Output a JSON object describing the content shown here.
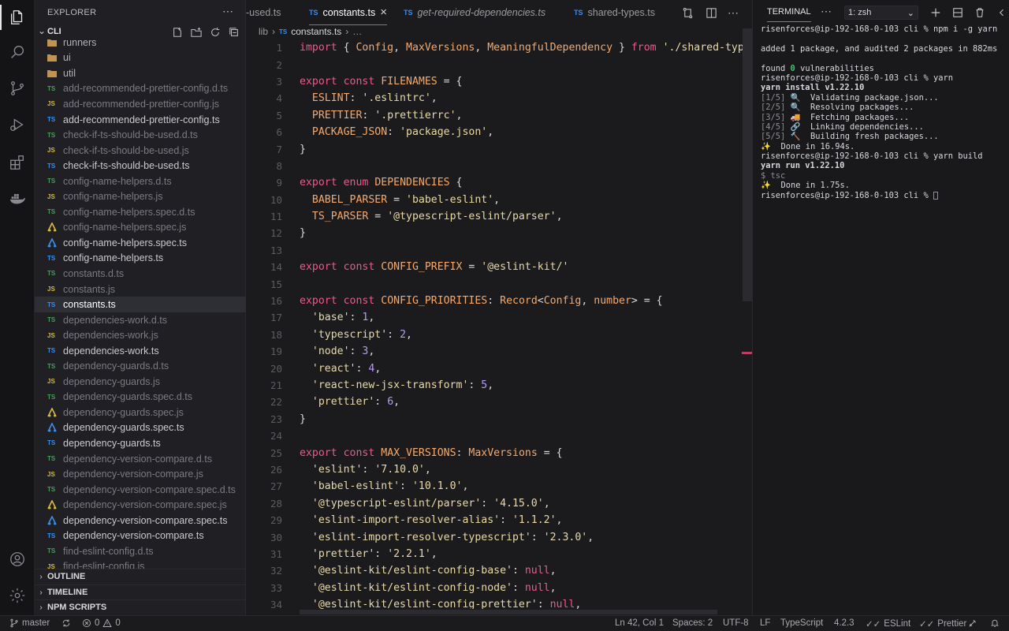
{
  "explorer": {
    "title": "EXPLORER",
    "folder": "CLI",
    "files": [
      {
        "name": "runners",
        "kind": "folder"
      },
      {
        "name": "ui",
        "kind": "folder"
      },
      {
        "name": "util",
        "kind": "folder"
      },
      {
        "name": "add-recommended-prettier-config.d.ts",
        "icon": "TS",
        "kind": "tsd"
      },
      {
        "name": "add-recommended-prettier-config.js",
        "icon": "JS",
        "kind": "js"
      },
      {
        "name": "add-recommended-prettier-config.ts",
        "icon": "TS",
        "kind": "ts"
      },
      {
        "name": "check-if-ts-should-be-used.d.ts",
        "icon": "TS",
        "kind": "tsd"
      },
      {
        "name": "check-if-ts-should-be-used.js",
        "icon": "JS",
        "kind": "js"
      },
      {
        "name": "check-if-ts-should-be-used.ts",
        "icon": "TS",
        "kind": "ts"
      },
      {
        "name": "config-name-helpers.d.ts",
        "icon": "TS",
        "kind": "tsd"
      },
      {
        "name": "config-name-helpers.js",
        "icon": "JS",
        "kind": "js"
      },
      {
        "name": "config-name-helpers.spec.d.ts",
        "icon": "TS",
        "kind": "tsd"
      },
      {
        "name": "config-name-helpers.spec.js",
        "icon": "jest",
        "kind": "jestjs"
      },
      {
        "name": "config-name-helpers.spec.ts",
        "icon": "jest",
        "kind": "jestts"
      },
      {
        "name": "config-name-helpers.ts",
        "icon": "TS",
        "kind": "ts"
      },
      {
        "name": "constants.d.ts",
        "icon": "TS",
        "kind": "tsd"
      },
      {
        "name": "constants.js",
        "icon": "JS",
        "kind": "js"
      },
      {
        "name": "constants.ts",
        "icon": "TS",
        "kind": "ts",
        "selected": true
      },
      {
        "name": "dependencies-work.d.ts",
        "icon": "TS",
        "kind": "tsd"
      },
      {
        "name": "dependencies-work.js",
        "icon": "JS",
        "kind": "js"
      },
      {
        "name": "dependencies-work.ts",
        "icon": "TS",
        "kind": "ts"
      },
      {
        "name": "dependency-guards.d.ts",
        "icon": "TS",
        "kind": "tsd"
      },
      {
        "name": "dependency-guards.js",
        "icon": "JS",
        "kind": "js"
      },
      {
        "name": "dependency-guards.spec.d.ts",
        "icon": "TS",
        "kind": "tsd"
      },
      {
        "name": "dependency-guards.spec.js",
        "icon": "jest",
        "kind": "jestjs"
      },
      {
        "name": "dependency-guards.spec.ts",
        "icon": "jest",
        "kind": "jestts"
      },
      {
        "name": "dependency-guards.ts",
        "icon": "TS",
        "kind": "ts"
      },
      {
        "name": "dependency-version-compare.d.ts",
        "icon": "TS",
        "kind": "tsd"
      },
      {
        "name": "dependency-version-compare.js",
        "icon": "JS",
        "kind": "js"
      },
      {
        "name": "dependency-version-compare.spec.d.ts",
        "icon": "TS",
        "kind": "tsd"
      },
      {
        "name": "dependency-version-compare.spec.js",
        "icon": "jest",
        "kind": "jestjs"
      },
      {
        "name": "dependency-version-compare.spec.ts",
        "icon": "jest",
        "kind": "jestts"
      },
      {
        "name": "dependency-version-compare.ts",
        "icon": "TS",
        "kind": "ts"
      },
      {
        "name": "find-eslint-config.d.ts",
        "icon": "TS",
        "kind": "tsd"
      },
      {
        "name": "find-eslint-config.js",
        "icon": "JS",
        "kind": "js"
      }
    ],
    "sections": [
      "OUTLINE",
      "TIMELINE",
      "NPM SCRIPTS"
    ]
  },
  "tabs": [
    {
      "label": "-used.ts",
      "icon": "",
      "active": false,
      "italic": false
    },
    {
      "label": "constants.ts",
      "icon": "TS",
      "active": true,
      "italic": false,
      "close": "×"
    },
    {
      "label": "get-required-dependencies.ts",
      "icon": "TS",
      "active": false,
      "italic": true
    },
    {
      "label": "shared-types.ts",
      "icon": "TS",
      "active": false,
      "italic": false
    }
  ],
  "breadcrumb": {
    "root": "lib",
    "sep": "›",
    "icon": "TS",
    "file": "constants.ts",
    "more": "…"
  },
  "code": [
    [
      [
        "k",
        "import"
      ],
      [
        "p",
        " { "
      ],
      [
        "t",
        "Config"
      ],
      [
        "p",
        ", "
      ],
      [
        "t",
        "MaxVersions"
      ],
      [
        "p",
        ", "
      ],
      [
        "t",
        "MeaningfulDependency"
      ],
      [
        "p",
        " } "
      ],
      [
        "k",
        "from"
      ],
      [
        "p",
        " "
      ],
      [
        "s",
        "'./shared-types'"
      ]
    ],
    [],
    [
      [
        "k",
        "export"
      ],
      [
        "p",
        " "
      ],
      [
        "k",
        "const"
      ],
      [
        "p",
        " "
      ],
      [
        "t",
        "FILENAMES"
      ],
      [
        "p",
        " = {"
      ]
    ],
    [
      [
        "p",
        "  "
      ],
      [
        "t",
        "ESLINT"
      ],
      [
        "p",
        ": "
      ],
      [
        "s",
        "'.eslintrc'"
      ],
      [
        "p",
        ","
      ]
    ],
    [
      [
        "p",
        "  "
      ],
      [
        "t",
        "PRETTIER"
      ],
      [
        "p",
        ": "
      ],
      [
        "s",
        "'.prettierrc'"
      ],
      [
        "p",
        ","
      ]
    ],
    [
      [
        "p",
        "  "
      ],
      [
        "t",
        "PACKAGE_JSON"
      ],
      [
        "p",
        ": "
      ],
      [
        "s",
        "'package.json'"
      ],
      [
        "p",
        ","
      ]
    ],
    [
      [
        "p",
        "}"
      ]
    ],
    [],
    [
      [
        "k",
        "export"
      ],
      [
        "p",
        " "
      ],
      [
        "k",
        "enum"
      ],
      [
        "p",
        " "
      ],
      [
        "t",
        "DEPENDENCIES"
      ],
      [
        "p",
        " {"
      ]
    ],
    [
      [
        "p",
        "  "
      ],
      [
        "t",
        "BABEL_PARSER"
      ],
      [
        "p",
        " = "
      ],
      [
        "s",
        "'babel-eslint'"
      ],
      [
        "p",
        ","
      ]
    ],
    [
      [
        "p",
        "  "
      ],
      [
        "t",
        "TS_PARSER"
      ],
      [
        "p",
        " = "
      ],
      [
        "s",
        "'@typescript-eslint/parser'"
      ],
      [
        "p",
        ","
      ]
    ],
    [
      [
        "p",
        "}"
      ]
    ],
    [],
    [
      [
        "k",
        "export"
      ],
      [
        "p",
        " "
      ],
      [
        "k",
        "const"
      ],
      [
        "p",
        " "
      ],
      [
        "t",
        "CONFIG_PREFIX"
      ],
      [
        "p",
        " = "
      ],
      [
        "s",
        "'@eslint-kit/'"
      ]
    ],
    [],
    [
      [
        "k",
        "export"
      ],
      [
        "p",
        " "
      ],
      [
        "k",
        "const"
      ],
      [
        "p",
        " "
      ],
      [
        "t",
        "CONFIG_PRIORITIES"
      ],
      [
        "p",
        ": "
      ],
      [
        "t",
        "Record"
      ],
      [
        "p",
        "<"
      ],
      [
        "t",
        "Config"
      ],
      [
        "p",
        ", "
      ],
      [
        "t",
        "number"
      ],
      [
        "p",
        "> = {"
      ]
    ],
    [
      [
        "p",
        "  "
      ],
      [
        "s",
        "'base'"
      ],
      [
        "p",
        ": "
      ],
      [
        "n",
        "1"
      ],
      [
        "p",
        ","
      ]
    ],
    [
      [
        "p",
        "  "
      ],
      [
        "s",
        "'typescript'"
      ],
      [
        "p",
        ": "
      ],
      [
        "n",
        "2"
      ],
      [
        "p",
        ","
      ]
    ],
    [
      [
        "p",
        "  "
      ],
      [
        "s",
        "'node'"
      ],
      [
        "p",
        ": "
      ],
      [
        "n",
        "3"
      ],
      [
        "p",
        ","
      ]
    ],
    [
      [
        "p",
        "  "
      ],
      [
        "s",
        "'react'"
      ],
      [
        "p",
        ": "
      ],
      [
        "n",
        "4"
      ],
      [
        "p",
        ","
      ]
    ],
    [
      [
        "p",
        "  "
      ],
      [
        "s",
        "'react-new-jsx-transform'"
      ],
      [
        "p",
        ": "
      ],
      [
        "n",
        "5"
      ],
      [
        "p",
        ","
      ]
    ],
    [
      [
        "p",
        "  "
      ],
      [
        "s",
        "'prettier'"
      ],
      [
        "p",
        ": "
      ],
      [
        "n",
        "6"
      ],
      [
        "p",
        ","
      ]
    ],
    [
      [
        "p",
        "}"
      ]
    ],
    [],
    [
      [
        "k",
        "export"
      ],
      [
        "p",
        " "
      ],
      [
        "k",
        "const"
      ],
      [
        "p",
        " "
      ],
      [
        "t",
        "MAX_VERSIONS"
      ],
      [
        "p",
        ": "
      ],
      [
        "t",
        "MaxVersions"
      ],
      [
        "p",
        " = {"
      ]
    ],
    [
      [
        "p",
        "  "
      ],
      [
        "s",
        "'eslint'"
      ],
      [
        "p",
        ": "
      ],
      [
        "s",
        "'7.10.0'"
      ],
      [
        "p",
        ","
      ]
    ],
    [
      [
        "p",
        "  "
      ],
      [
        "s",
        "'babel-eslint'"
      ],
      [
        "p",
        ": "
      ],
      [
        "s",
        "'10.1.0'"
      ],
      [
        "p",
        ","
      ]
    ],
    [
      [
        "p",
        "  "
      ],
      [
        "s",
        "'@typescript-eslint/parser'"
      ],
      [
        "p",
        ": "
      ],
      [
        "s",
        "'4.15.0'"
      ],
      [
        "p",
        ","
      ]
    ],
    [
      [
        "p",
        "  "
      ],
      [
        "s",
        "'eslint-import-resolver-alias'"
      ],
      [
        "p",
        ": "
      ],
      [
        "s",
        "'1.1.2'"
      ],
      [
        "p",
        ","
      ]
    ],
    [
      [
        "p",
        "  "
      ],
      [
        "s",
        "'eslint-import-resolver-typescript'"
      ],
      [
        "p",
        ": "
      ],
      [
        "s",
        "'2.3.0'"
      ],
      [
        "p",
        ","
      ]
    ],
    [
      [
        "p",
        "  "
      ],
      [
        "s",
        "'prettier'"
      ],
      [
        "p",
        ": "
      ],
      [
        "s",
        "'2.2.1'"
      ],
      [
        "p",
        ","
      ]
    ],
    [
      [
        "p",
        "  "
      ],
      [
        "s",
        "'@eslint-kit/eslint-config-base'"
      ],
      [
        "p",
        ": "
      ],
      [
        "k",
        "null"
      ],
      [
        "p",
        ","
      ]
    ],
    [
      [
        "p",
        "  "
      ],
      [
        "s",
        "'@eslint-kit/eslint-config-node'"
      ],
      [
        "p",
        ": "
      ],
      [
        "k",
        "null"
      ],
      [
        "p",
        ","
      ]
    ],
    [
      [
        "p",
        "  "
      ],
      [
        "s",
        "'@eslint-kit/eslint-config-prettier'"
      ],
      [
        "p",
        ": "
      ],
      [
        "k",
        "null"
      ],
      [
        "p",
        ","
      ]
    ]
  ],
  "terminal": {
    "tab": "TERMINAL",
    "shell": "1: zsh",
    "lines": [
      {
        "text": "risenforces@ip-192-168-0-103 cli % npm i -g yarn"
      },
      {
        "text": ""
      },
      {
        "text": "added 1 package, and audited 2 packages in 882ms"
      },
      {
        "text": ""
      },
      {
        "parts": [
          [
            "",
            "found "
          ],
          [
            "g",
            "0"
          ],
          [
            "",
            " vulnerabilities"
          ]
        ]
      },
      {
        "text": "risenforces@ip-192-168-0-103 cli % yarn"
      },
      {
        "text": "yarn install v1.22.10",
        "bold": true
      },
      {
        "parts": [
          [
            "dim",
            "[1/5]"
          ],
          [
            "",
            " 🔍  Validating package.json..."
          ]
        ]
      },
      {
        "parts": [
          [
            "dim",
            "[2/5]"
          ],
          [
            "",
            " 🔍  Resolving packages..."
          ]
        ]
      },
      {
        "parts": [
          [
            "dim",
            "[3/5]"
          ],
          [
            "",
            " 🚚  Fetching packages..."
          ]
        ]
      },
      {
        "parts": [
          [
            "dim",
            "[4/5]"
          ],
          [
            "",
            " 🔗  Linking dependencies..."
          ]
        ]
      },
      {
        "parts": [
          [
            "dim",
            "[5/5]"
          ],
          [
            "",
            " 🔨  Building fresh packages..."
          ]
        ]
      },
      {
        "text": "✨  Done in 16.94s."
      },
      {
        "text": "risenforces@ip-192-168-0-103 cli % yarn build"
      },
      {
        "text": "yarn run v1.22.10",
        "bold": true
      },
      {
        "text": "$ tsc",
        "dim": true
      },
      {
        "text": "✨  Done in 1.75s."
      },
      {
        "text": "risenforces@ip-192-168-0-103 cli % ",
        "cursor": true
      }
    ]
  },
  "status": {
    "branch": "master",
    "errors": "0",
    "warnings": "0",
    "position": "Ln 42, Col 1",
    "spaces": "Spaces: 2",
    "encoding": "UTF-8",
    "eol": "LF",
    "language": "TypeScript",
    "ts_version": "4.2.3",
    "eslint": "ESLint",
    "prettier": "Prettier"
  },
  "colors": {
    "accent": "#e04a78",
    "ts": "#3b8eea",
    "js": "#d7ba3c",
    "keyword": "#f0578e",
    "type": "#f6a96b",
    "string": "#e9d9a8"
  }
}
